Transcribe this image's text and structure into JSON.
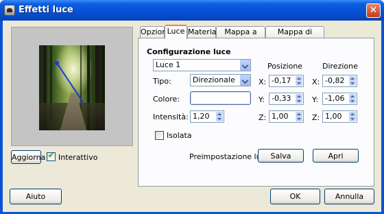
{
  "window": {
    "title": "Effetti luce",
    "close_glyph": "✕"
  },
  "left": {
    "refresh_label": "Aggiorna",
    "interactive_label": "Interattivo",
    "interactive_checked": true
  },
  "tabs": [
    {
      "label": "Opzioni",
      "active": false
    },
    {
      "label": "Luce",
      "active": true
    },
    {
      "label": "Materiali",
      "active": false
    },
    {
      "label": "Mappa a sbalzo",
      "active": false
    },
    {
      "label": "Mappa di ambiente",
      "active": false
    }
  ],
  "light": {
    "section_title": "Configurazione luce",
    "light_select": "Luce 1",
    "type_label": "Tipo:",
    "type_value": "Direzionale",
    "color_label": "Colore:",
    "color_value": "#ffffff",
    "intensity_label": "Intensità:",
    "intensity_value": "1,20",
    "isolated_label": "Isolata",
    "isolated_checked": false,
    "position_header": "Posizione",
    "direction_header": "Direzione",
    "position": [
      {
        "axis": "X:",
        "value": "-0,17"
      },
      {
        "axis": "Y:",
        "value": "-0,33"
      },
      {
        "axis": "Z:",
        "value": "1,00"
      }
    ],
    "direction": [
      {
        "axis": "X:",
        "value": "-0,82"
      },
      {
        "axis": "Y:",
        "value": "-1,06"
      },
      {
        "axis": "Z:",
        "value": "1,00"
      }
    ],
    "preset_label": "Preimpostazione luce:",
    "save_label": "Salva",
    "open_label": "Apri"
  },
  "footer": {
    "help_label": "Aiuto",
    "ok_label": "OK",
    "cancel_label": "Annulla"
  }
}
